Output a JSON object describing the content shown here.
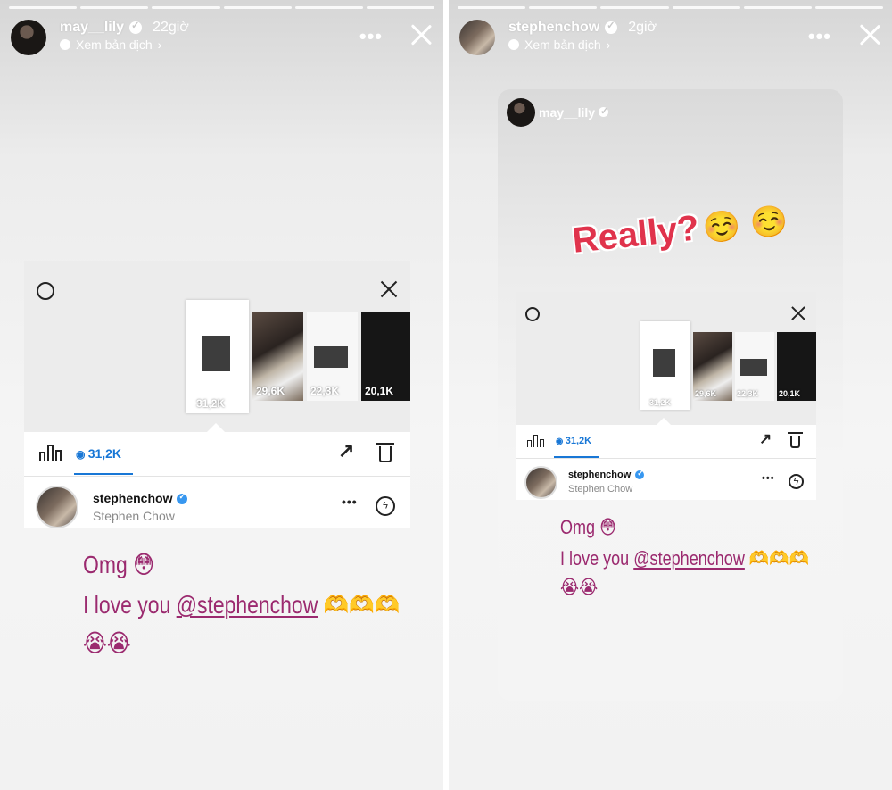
{
  "left_story": {
    "username": "may__lily",
    "time": "22giờ",
    "translate": "Xem bản dịch",
    "menu": "•••",
    "insights": {
      "thumbs": [
        {
          "views": "31,2K",
          "kind": "white"
        },
        {
          "views": "29,6K",
          "kind": "photo1"
        },
        {
          "views": "22,3K",
          "kind": "photo2"
        },
        {
          "views": "20,1K",
          "kind": "black"
        }
      ],
      "view_count": "31,2K",
      "viewer": {
        "username": "stephenchow",
        "full_name": "Stephen Chow"
      },
      "more": "•••"
    },
    "caption": {
      "line1_text": "Omg",
      "line1_emoji": "😳",
      "line2_text": "I love you",
      "line2_mention": "@stephenchow",
      "line2_emoji": "🫶🫶🫶",
      "line3_emoji": "😭😭"
    }
  },
  "right_story": {
    "username": "stephenchow",
    "time": "2giờ",
    "translate": "Xem bản dịch",
    "menu": "•••",
    "shared": {
      "username": "may__lily",
      "sticker_text": "Really?",
      "sticker_emoji": "☺️ ☺️"
    },
    "insights": {
      "thumbs": [
        {
          "views": "31,2K",
          "kind": "white"
        },
        {
          "views": "29,6K",
          "kind": "photo1"
        },
        {
          "views": "22,3K",
          "kind": "photo2"
        },
        {
          "views": "20,1K",
          "kind": "black"
        }
      ],
      "view_count": "31,2K",
      "viewer": {
        "username": "stephenchow",
        "full_name": "Stephen Chow"
      },
      "more": "•••"
    },
    "caption": {
      "line1_text": "Omg",
      "line1_emoji": "😳",
      "line2_text": "I love you",
      "line2_mention": "@stephenchow",
      "line2_emoji": "🫶🫶🫶",
      "line3_emoji": "😭😭"
    }
  }
}
